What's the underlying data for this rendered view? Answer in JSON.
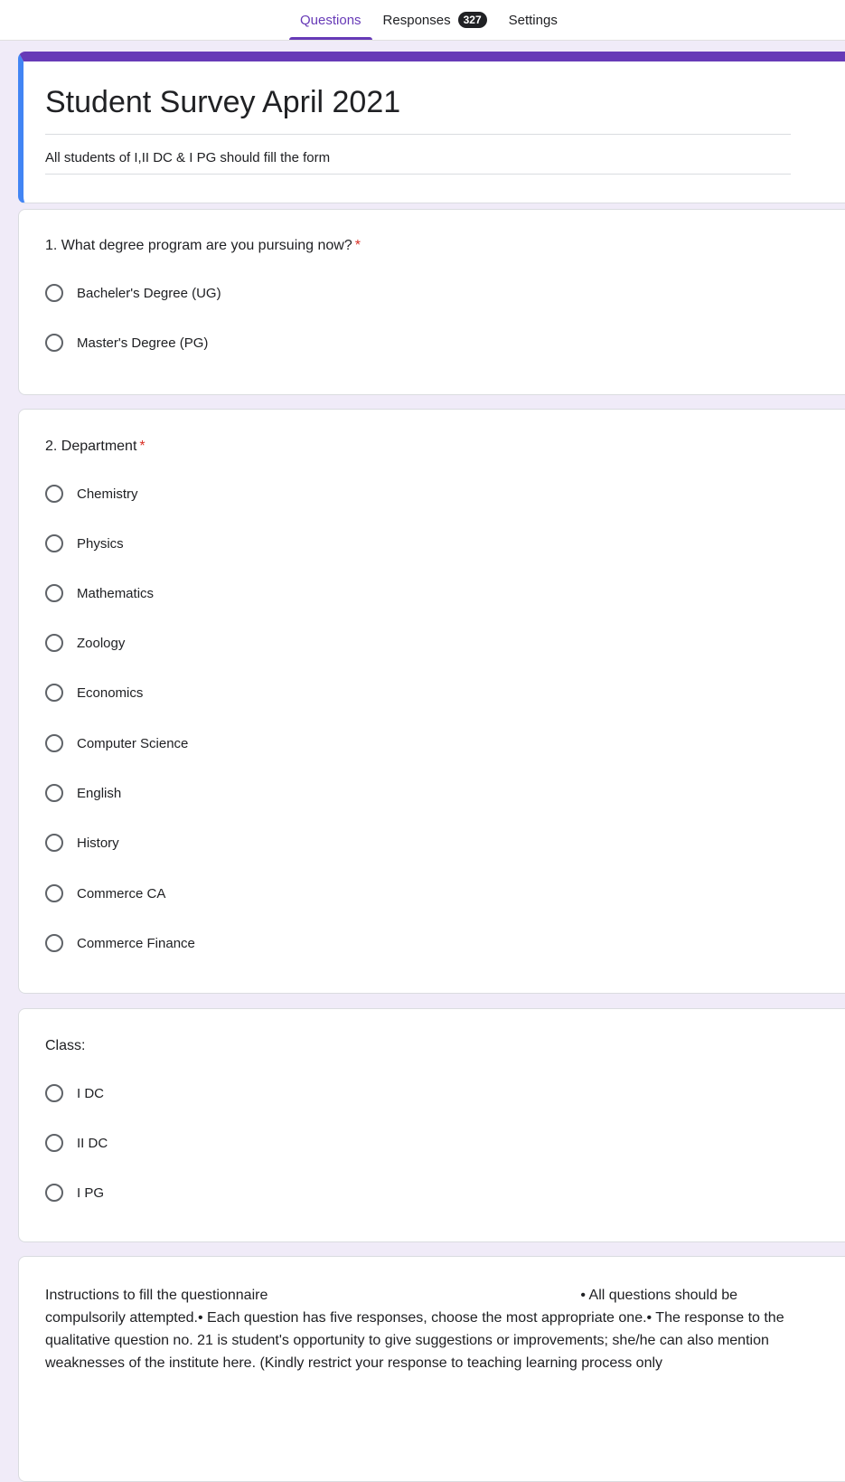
{
  "tabs": {
    "questions": "Questions",
    "responses": "Responses",
    "responses_count": "327",
    "settings": "Settings"
  },
  "form": {
    "title": "Student Survey April 2021",
    "description": "All students of I,II DC & I PG should fill the form"
  },
  "questions": [
    {
      "title": "1. What degree program are you pursuing now?",
      "required": "*",
      "options": [
        "Bacheler's Degree (UG)",
        "Master's Degree (PG)"
      ]
    },
    {
      "title": "2. Department",
      "required": "*",
      "options": [
        "Chemistry",
        "Physics",
        "Mathematics",
        "Zoology",
        "Economics",
        "Computer Science",
        "English",
        "History",
        "Commerce CA",
        "Commerce Finance"
      ]
    },
    {
      "title": "Class:",
      "options": [
        "I DC",
        "II DC",
        "I PG"
      ]
    }
  ],
  "instructions": {
    "heading": "Instructions to fill the questionnaire",
    "body": "• All questions should be compulsorily attempted.• Each question has five responses, choose the most appropriate one.• The response to the qualitative question no. 21 is student's opportunity to give suggestions or improvements; she/he can also mention weaknesses of the institute here. (Kindly restrict your response to teaching learning process only"
  }
}
